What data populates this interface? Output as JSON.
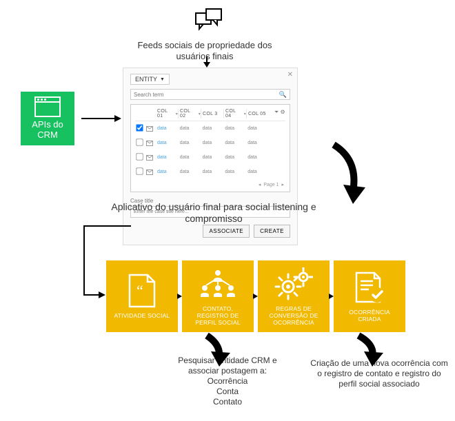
{
  "feeds_label": "Feeds sociais de propriedade dos usuários finais",
  "api_box_label": "APIs do CRM",
  "app_listening_label": "Aplicativo do usuário final para social listening e compromisso",
  "pesquisar_label": "Pesquisar entidade CRM e associar postagem a:\nOcorrência\nConta\nContato",
  "criacao_label": "Criação de uma nova ocorrência com o registro de contato e registro do perfil social associado",
  "app_window": {
    "entity_label": "ENTITY",
    "search_placeholder": "Search term",
    "columns": [
      "COL 01",
      "COL 02",
      "COL 3",
      "COL 04",
      "COL 05"
    ],
    "rows": [
      {
        "checked": true,
        "cells": [
          "data",
          "data",
          "data",
          "data",
          "data"
        ]
      },
      {
        "checked": false,
        "cells": [
          "data",
          "data",
          "data",
          "data",
          "data"
        ]
      },
      {
        "checked": false,
        "cells": [
          "data",
          "data",
          "data",
          "data",
          "data"
        ]
      },
      {
        "checked": false,
        "cells": [
          "data",
          "data",
          "data",
          "data",
          "data"
        ]
      }
    ],
    "pager": "Page 1",
    "case_title_label": "Case title",
    "case_title_placeholder": "Enter the case title here...",
    "associate_btn": "ASSOCIATE",
    "create_btn": "CREATE"
  },
  "steps": {
    "s1": "ATIVIDADE SOCIAL",
    "s2": "CONTATO, REGISTRO DE PERFIL SOCIAL",
    "s3": "REGRAS DE CONVERSÃO DE OCORRÊNCIA",
    "s4": "OCORRÊNCIA CRIADA"
  }
}
